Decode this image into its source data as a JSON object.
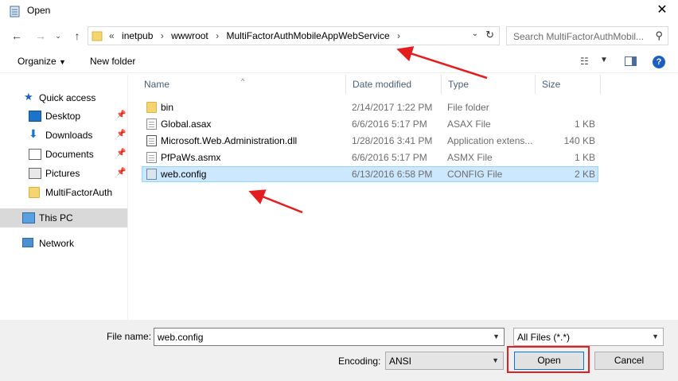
{
  "window": {
    "title": "Open",
    "icon": "notepad-icon",
    "close_icon": "close-icon"
  },
  "nav": {
    "back_icon": "arrow-left-icon",
    "forward_icon": "arrow-right-icon",
    "recent_icon": "chevron-down-icon",
    "up_icon": "arrow-up-icon",
    "address": {
      "overflow": "«",
      "crumbs": [
        "inetpub",
        "wwwroot",
        "MultiFactorAuthMobileAppWebService"
      ],
      "separator": "›"
    },
    "search_placeholder": "Search MultiFactorAuthMobil..."
  },
  "toolbar": {
    "organize": "Organize",
    "new_folder": "New folder",
    "help": "?"
  },
  "sidebar": [
    {
      "label": "Quick access",
      "icon": "star-icon"
    },
    {
      "label": "Desktop",
      "icon": "desktop-icon",
      "pinned": true
    },
    {
      "label": "Downloads",
      "icon": "download-icon",
      "pinned": true
    },
    {
      "label": "Documents",
      "icon": "documents-icon",
      "pinned": true
    },
    {
      "label": "Pictures",
      "icon": "pictures-icon",
      "pinned": true
    },
    {
      "label": "MultiFactorAuth",
      "icon": "folder-icon"
    },
    {
      "label": "This PC",
      "icon": "computer-icon",
      "selected": true
    },
    {
      "label": "Network",
      "icon": "network-icon"
    }
  ],
  "columns": {
    "name": "Name",
    "date": "Date modified",
    "type": "Type",
    "size": "Size"
  },
  "files": [
    {
      "name": "bin",
      "date": "2/14/2017 1:22 PM",
      "type": "File folder",
      "size": "",
      "icon": "folder-icon"
    },
    {
      "name": "Global.asax",
      "date": "6/6/2016 5:17 PM",
      "type": "ASAX File",
      "size": "1 KB",
      "icon": "file-icon"
    },
    {
      "name": "Microsoft.Web.Administration.dll",
      "date": "1/28/2016 3:41 PM",
      "type": "Application extens...",
      "size": "140 KB",
      "icon": "dll-file-icon"
    },
    {
      "name": "PfPaWs.asmx",
      "date": "6/6/2016 5:17 PM",
      "type": "ASMX File",
      "size": "1 KB",
      "icon": "file-icon"
    },
    {
      "name": "web.config",
      "date": "6/13/2016 6:58 PM",
      "type": "CONFIG File",
      "size": "2 KB",
      "icon": "config-file-icon",
      "selected": true
    }
  ],
  "footer": {
    "filename_label": "File name:",
    "filename_value": "web.config",
    "filter_value": "All Files  (*.*)",
    "encoding_label": "Encoding:",
    "encoding_value": "ANSI",
    "open": "Open",
    "cancel": "Cancel"
  },
  "colors": {
    "selection": "#cce8ff",
    "annotation": "#e21e1e",
    "accent": "#0078d7"
  }
}
